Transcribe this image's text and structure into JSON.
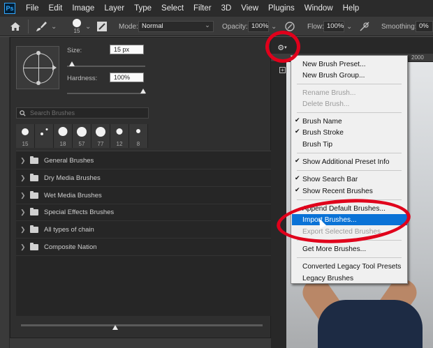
{
  "app": {
    "logo_text": "Ps",
    "accent": "#31a8ff"
  },
  "menubar": [
    "File",
    "Edit",
    "Image",
    "Layer",
    "Type",
    "Select",
    "Filter",
    "3D",
    "View",
    "Plugins",
    "Window",
    "Help"
  ],
  "options": {
    "brush_size": "15",
    "mode_label": "Mode:",
    "mode_value": "Normal",
    "opacity_label": "Opacity:",
    "opacity_value": "100%",
    "flow_label": "Flow:",
    "flow_value": "100%",
    "smoothing_label": "Smoothing:",
    "smoothing_value": "0%"
  },
  "ruler": {
    "mark": "2000"
  },
  "brush_panel": {
    "size_label": "Size:",
    "size_value": "15 px",
    "hardness_label": "Hardness:",
    "hardness_value": "100%",
    "search_placeholder": "Search Brushes",
    "recent_brushes": [
      "15",
      "",
      "18",
      "57",
      "77",
      "12",
      "8"
    ],
    "folders": [
      "General Brushes",
      "Dry Media Brushes",
      "Wet Media Brushes",
      "Special Effects Brushes",
      "All types of chain",
      "Composite Nation"
    ]
  },
  "context_menu": {
    "items": [
      {
        "label": "New Brush Preset...",
        "disabled": false,
        "checked": false
      },
      {
        "label": "New Brush Group...",
        "disabled": false,
        "checked": false
      },
      {
        "label": "Rename Brush...",
        "disabled": true,
        "checked": false
      },
      {
        "label": "Delete Brush...",
        "disabled": true,
        "checked": false
      },
      {
        "label": "Brush Name",
        "disabled": false,
        "checked": true
      },
      {
        "label": "Brush Stroke",
        "disabled": false,
        "checked": true
      },
      {
        "label": "Brush Tip",
        "disabled": false,
        "checked": false
      },
      {
        "label": "Show Additional Preset Info",
        "disabled": false,
        "checked": true
      },
      {
        "label": "Show Search Bar",
        "disabled": false,
        "checked": true
      },
      {
        "label": "Show Recent Brushes",
        "disabled": false,
        "checked": true
      },
      {
        "label": "Append Default Brushes...",
        "disabled": false,
        "checked": false
      },
      {
        "label": "Import Brushes...",
        "disabled": false,
        "checked": false,
        "highlighted": true
      },
      {
        "label": "Export Selected Brushes...",
        "disabled": true,
        "checked": false
      },
      {
        "label": "Get More Brushes...",
        "disabled": false,
        "checked": false
      },
      {
        "label": "Converted Legacy Tool Presets",
        "disabled": false,
        "checked": false
      },
      {
        "label": "Legacy Brushes",
        "disabled": false,
        "checked": false
      }
    ]
  },
  "colors": {
    "highlight": "#0a72d6",
    "annotation": "#e0001b"
  }
}
